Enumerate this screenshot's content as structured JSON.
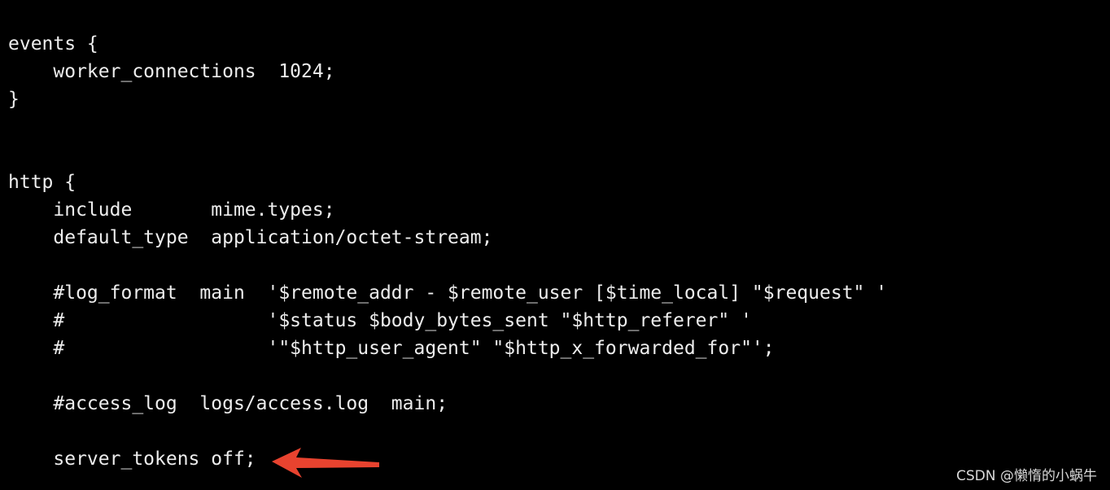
{
  "terminal": {
    "lines": [
      "events {",
      "    worker_connections  1024;",
      "}",
      "",
      "",
      "http {",
      "    include       mime.types;",
      "    default_type  application/octet-stream;",
      "",
      "    #log_format  main  '$remote_addr - $remote_user [$time_local] \"$request\" '",
      "    #                  '$status $body_bytes_sent \"$http_referer\" '",
      "    #                  '\"$http_user_agent\" \"$http_x_forwarded_for\"';",
      "",
      "    #access_log  logs/access.log  main;",
      "",
      "    server_tokens off;"
    ],
    "background_color": "#000000",
    "text_color": "#ededed"
  },
  "annotation": {
    "icon": "arrow-left-icon",
    "color": "#e8432f"
  },
  "watermark": {
    "text": "CSDN @懒惰的小蜗牛"
  }
}
